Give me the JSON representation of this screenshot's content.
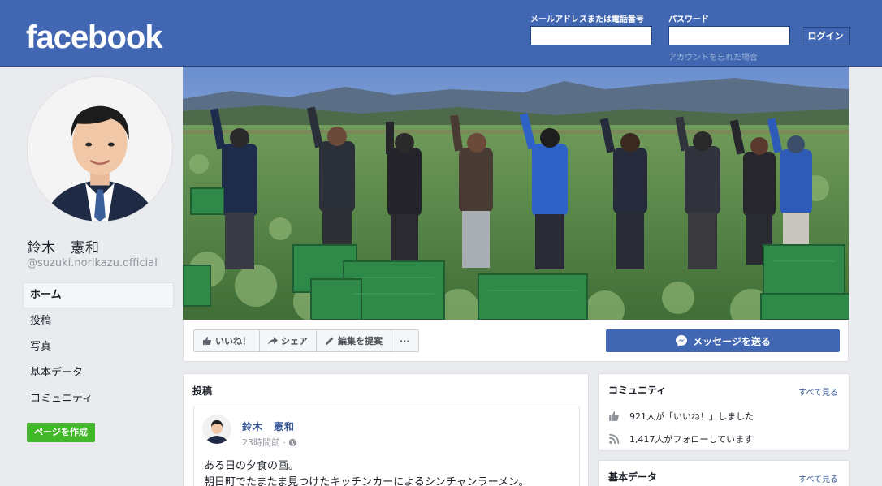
{
  "header": {
    "logo": "facebook",
    "email_label": "メールアドレスまたは電話番号",
    "email_value": "",
    "password_label": "パスワード",
    "password_value": "",
    "login_label": "ログイン",
    "forgot_label": "アカウントを忘れた場合"
  },
  "profile": {
    "name": "鈴木　憲和",
    "handle": "@suzuki.norikazu.official"
  },
  "nav": {
    "items": [
      {
        "label": "ホーム",
        "active": true
      },
      {
        "label": "投稿"
      },
      {
        "label": "写真"
      },
      {
        "label": "基本データ"
      },
      {
        "label": "コミュニティ"
      }
    ],
    "create_page": "ページを作成"
  },
  "actions": {
    "like": "いいね！",
    "share": "シェア",
    "suggest_edit": "編集を提案",
    "more": "···",
    "message": "メッセージを送る"
  },
  "posts": {
    "title": "投稿",
    "post": {
      "author": "鈴木　憲和",
      "time": "23時間前 ·",
      "line1": "ある日の夕食の画。",
      "line2": "朝日町でたまたま見つけたキッチンカーによるシンチャンラーメン。"
    }
  },
  "community": {
    "title": "コミュニティ",
    "see_all": "すべて見る",
    "likes": "921人が「いいね！」しました",
    "follows": "1,417人がフォローしています"
  },
  "about": {
    "title": "基本データ",
    "see_all": "すべて見る"
  },
  "colors": {
    "brand": "#4267b2",
    "link": "#385898",
    "create_green": "#42b72a",
    "background": "#e9ebee"
  }
}
